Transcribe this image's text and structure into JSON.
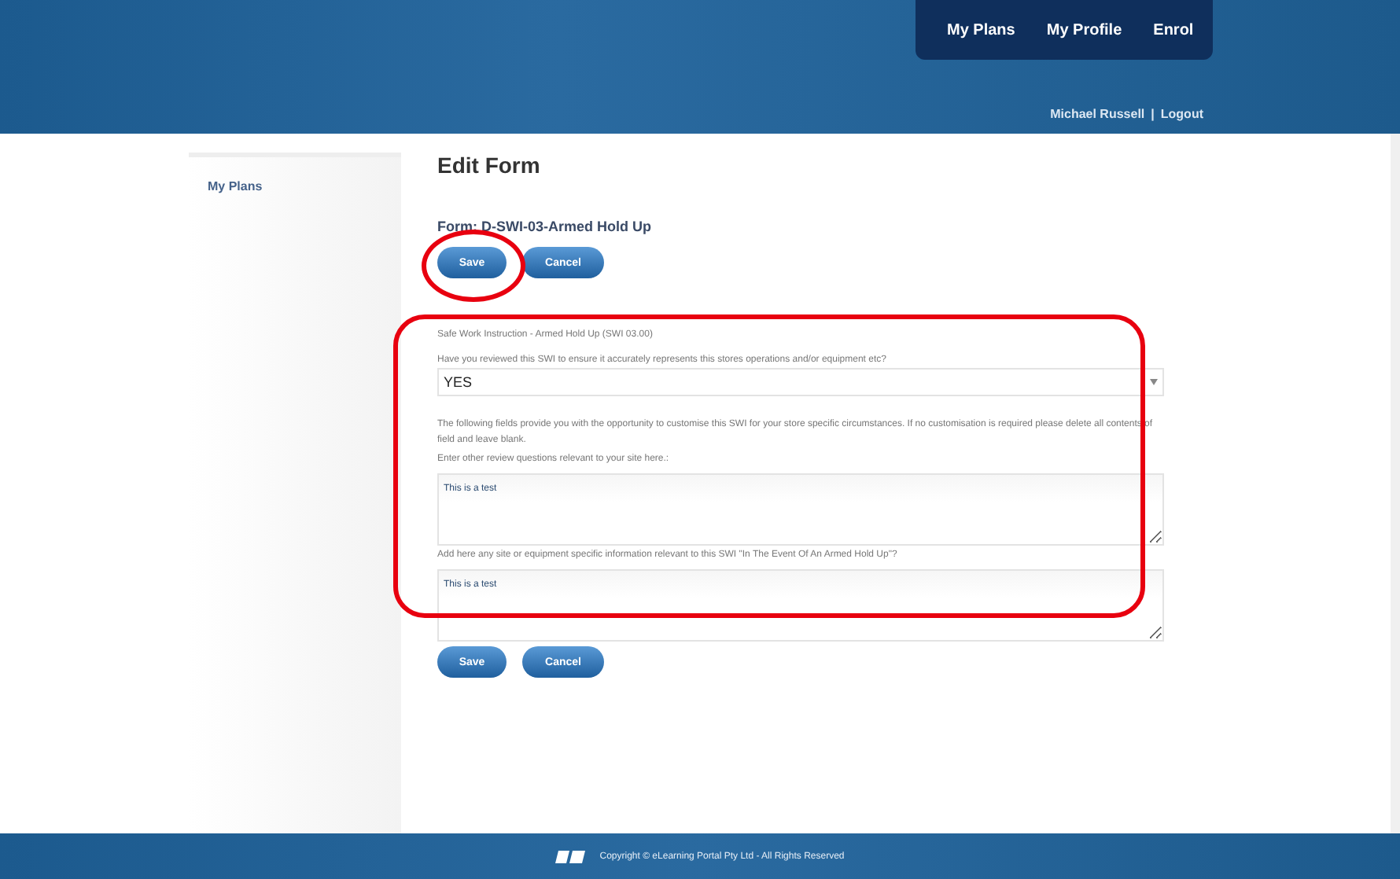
{
  "nav": {
    "items": [
      {
        "label": "My Plans"
      },
      {
        "label": "My Profile"
      },
      {
        "label": "Enrol"
      }
    ],
    "user": "Michael Russell",
    "separator": "|",
    "logout": "Logout"
  },
  "sidebar": {
    "items": [
      {
        "label": "My Plans"
      }
    ]
  },
  "page_title": "Edit Form",
  "form_name": "Form: D-SWI-03-Armed Hold Up",
  "top_buttons": [
    "Save",
    "Cancel"
  ],
  "form": {
    "heading": "Safe Work Instruction - Armed Hold Up (SWI 03.00)",
    "question": "Have you reviewed this SWI to ensure it accurately represents this stores operations and/or equipment etc?",
    "select_value": "YES",
    "note": "The following fields provide you with the opportunity to customise this SWI for your store specific circumstances. If no customisation is required please delete all contents of field and leave blank.",
    "fields": [
      {
        "label": "Enter other review questions relevant to your site here.:",
        "value": "This is a test"
      },
      {
        "label": "Add here any site or equipment specific information relevant to this SWI \"In The Event Of An Armed Hold Up\"?",
        "value": "This is a test"
      }
    ]
  },
  "bottom_buttons": [
    "Save",
    "Cancel"
  ],
  "footer": "Copyright © eLearning Portal Pty Ltd - All Rights Reserved"
}
